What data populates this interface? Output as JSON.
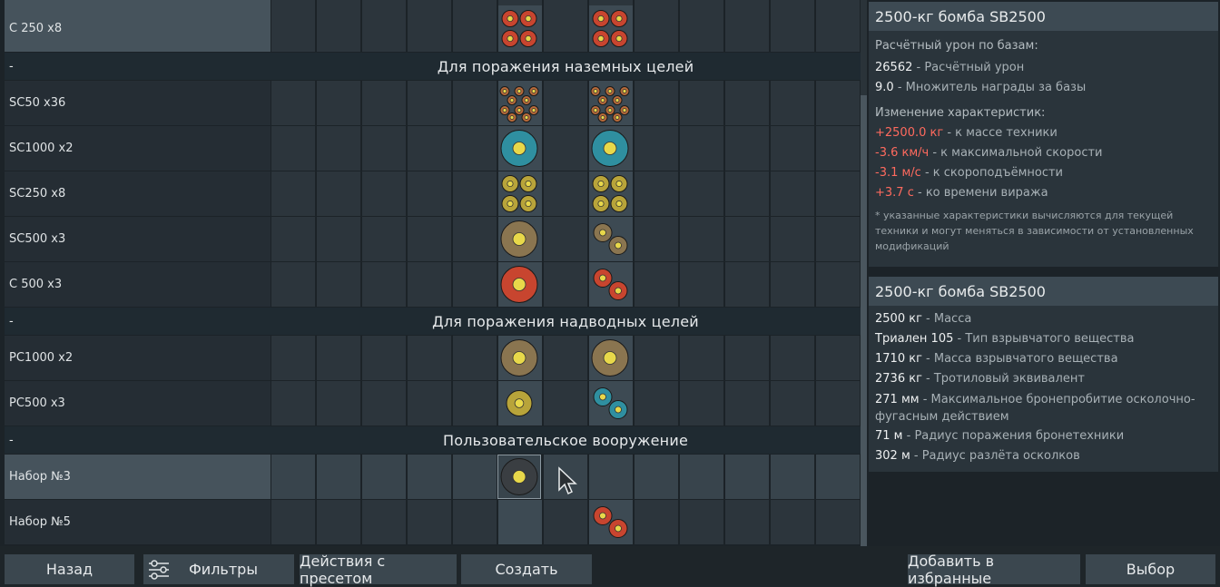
{
  "rows": {
    "c250": "С 250 x8",
    "section1": "Для поражения наземных целей",
    "sc50": "SC50 x36",
    "sc1000": "SC1000 x2",
    "sc250": "SC250 x8",
    "sc500": "SC500 x3",
    "c500": "С 500 x3",
    "section2": "Для поражения надводных целей",
    "pc1000": "PC1000 x2",
    "pc500": "PC500 x3",
    "section3": "Пользовательское вооружение",
    "set3": "Набор №3",
    "set5": "Набор №5",
    "dash": "-"
  },
  "info": {
    "title": "2500-кг бомба SB2500",
    "damage_header": "Расчётный урон по базам:",
    "damage_value": "26562",
    "damage_label": " - Расчётный урон",
    "reward_value": "9.0",
    "reward_label": " - Множитель награды за базы",
    "changes_header": "Изменение характеристик:",
    "mass_value": "+2500.0 кг",
    "mass_label": " - к массе техники",
    "speed_value": "-3.6 км/ч",
    "speed_label": " - к максимальной скорости",
    "climb_value": "-3.1 м/с",
    "climb_label": " - к скороподъёмности",
    "turn_value": "+3.7 с",
    "turn_label": " - ко времени виража",
    "note": "* указанные характеристики вычисляются для текущей техники и могут меняться в зависимости от установленных модификаций"
  },
  "specs": {
    "title": "2500-кг бомба SB2500",
    "mass_value": "2500 кг",
    "mass_label": " - Масса",
    "explosive_value": "Триален 105",
    "explosive_label": " - Тип взрывчатого вещества",
    "explosive_mass_value": "1710 кг",
    "explosive_mass_label": " - Масса взрывчатого вещества",
    "tnt_value": "2736 кг",
    "tnt_label": " - Тротиловый эквивалент",
    "pen_value": "271 мм",
    "pen_label": " - Максимальное бронепробитие осколочно-фугасным действием",
    "radius_armor_value": "71 м",
    "radius_armor_label": " - Радиус поражения бронетехники",
    "radius_frag_value": "302 м",
    "radius_frag_label": " - Радиус разлёта осколков"
  },
  "buttons": {
    "back": "Назад",
    "filters": "Фильтры",
    "preset": "Действия с пресетом",
    "create": "Создать",
    "favorite": "Добавить в избранные",
    "select": "Выбор"
  },
  "colors": {
    "red_bomb": "#c8452f",
    "orange_bomb": "#b86a3a",
    "teal_bomb": "#2f8fa0",
    "yellow_bomb": "#b8a43a",
    "bronze_bomb": "#8a7550",
    "dark_bomb": "#3a3e42",
    "negative": "#ff6a5e"
  }
}
